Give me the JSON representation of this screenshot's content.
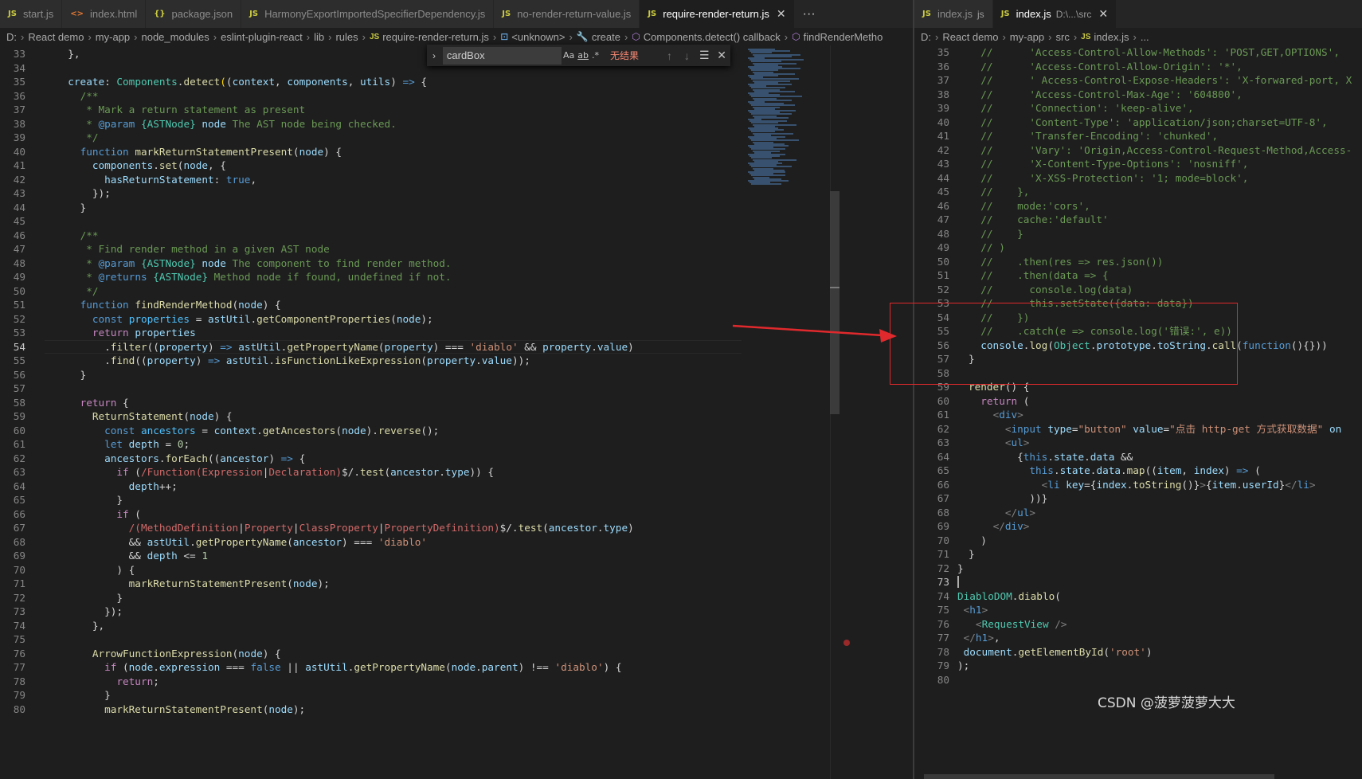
{
  "left_tabs": [
    {
      "icon": "JS",
      "label": "start.js",
      "active": false
    },
    {
      "icon": "<>",
      "label": "index.html",
      "active": false
    },
    {
      "icon": "{}",
      "label": "package.json",
      "active": false
    },
    {
      "icon": "JS",
      "label": "HarmonyExportImportedSpecifierDependency.js",
      "active": false
    },
    {
      "icon": "JS",
      "label": "no-render-return-value.js",
      "active": false
    },
    {
      "icon": "JS",
      "label": "require-render-return.js",
      "active": true
    }
  ],
  "left_more": "···",
  "right_tabs": [
    {
      "icon": "JS",
      "label": "index.js",
      "desc": "js",
      "active": false
    },
    {
      "icon": "JS",
      "label": "index.js",
      "desc": "D:\\...\\src",
      "active": true
    }
  ],
  "left_breadcrumbs": [
    "D:",
    "React demo",
    "my-app",
    "node_modules",
    "eslint-plugin-react",
    "lib",
    "rules",
    "require-render-return.js",
    "<unknown>",
    "create",
    "Components.detect() callback",
    "findRenderMetho"
  ],
  "right_breadcrumbs": [
    "D:",
    "React demo",
    "my-app",
    "src",
    "index.js",
    "..."
  ],
  "find": {
    "query": "cardBox",
    "case": "Aa",
    "word": "ab",
    "regex": ".*",
    "result": "无结果"
  },
  "left_lines": [
    {
      "n": "33",
      "h": "  },"
    },
    {
      "n": "34",
      "h": ""
    },
    {
      "n": "35",
      "h": "  <span class=\"v\">create</span>: <span class=\"cls\">Components</span>.<span class=\"f\">detect</span><span class=\"br\">(</span>(<span class=\"v\">context</span>, <span class=\"v\">components</span>, <span class=\"v\">utils</span>) <span class=\"k\">=&gt;</span> {"
    },
    {
      "n": "36",
      "h": "    <span class=\"cm\">/**</span>"
    },
    {
      "n": "37",
      "h": "<span class=\"cm\">     * Mark a return statement as present</span>"
    },
    {
      "n": "38",
      "h": "<span class=\"cm\">     * </span><span class=\"k\">@param</span> <span class=\"cls\">{ASTNode}</span> <span class=\"v\">node</span><span class=\"cm\"> The AST node being checked.</span>"
    },
    {
      "n": "39",
      "h": "<span class=\"cm\">     */</span>"
    },
    {
      "n": "40",
      "h": "    <span class=\"k\">function</span> <span class=\"f\">markReturnStatementPresent</span>(<span class=\"v\">node</span>) {"
    },
    {
      "n": "41",
      "h": "      <span class=\"v\">components</span>.<span class=\"f\">set</span>(<span class=\"v\">node</span>, {"
    },
    {
      "n": "42",
      "h": "        <span class=\"v\">hasReturnStatement</span>: <span class=\"k\">true</span>,"
    },
    {
      "n": "43",
      "h": "      });"
    },
    {
      "n": "44",
      "h": "    }"
    },
    {
      "n": "45",
      "h": ""
    },
    {
      "n": "46",
      "h": "    <span class=\"cm\">/**</span>"
    },
    {
      "n": "47",
      "h": "<span class=\"cm\">     * Find render method in a given AST node</span>"
    },
    {
      "n": "48",
      "h": "<span class=\"cm\">     * </span><span class=\"k\">@param</span> <span class=\"cls\">{ASTNode}</span> <span class=\"v\">node</span><span class=\"cm\"> The component to find render method.</span>"
    },
    {
      "n": "49",
      "h": "<span class=\"cm\">     * </span><span class=\"k\">@returns</span> <span class=\"cls\">{ASTNode}</span><span class=\"cm\"> Method node if found, undefined if not.</span>"
    },
    {
      "n": "50",
      "h": "<span class=\"cm\">     */</span>"
    },
    {
      "n": "51",
      "h": "    <span class=\"k\">function</span> <span class=\"f\">findRenderMethod</span>(<span class=\"v\">node</span>) {"
    },
    {
      "n": "52",
      "h": "      <span class=\"k\">const</span> <span class=\"cv\">properties</span> = <span class=\"v\">astUtil</span>.<span class=\"f\">getComponentProperties</span>(<span class=\"v\">node</span>);"
    },
    {
      "n": "53",
      "h": "      <span class=\"c\">return</span> <span class=\"v\">properties</span>"
    },
    {
      "n": "54",
      "h": "        .<span class=\"f\">filter</span>((<span class=\"v\">property</span>) <span class=\"k\">=&gt;</span> <span class=\"v\">astUtil</span>.<span class=\"f\">getPropertyName</span>(<span class=\"v\">property</span>) === <span class=\"s\">'diablo'</span> &amp;&amp; <span class=\"v\">property</span>.<span class=\"v\">value</span>)",
      "cur": true
    },
    {
      "n": "55",
      "h": "        .<span class=\"f\">find</span>((<span class=\"v\">property</span>) <span class=\"k\">=&gt;</span> <span class=\"v\">astUtil</span>.<span class=\"f\">isFunctionLikeExpression</span>(<span class=\"v\">property</span>.<span class=\"v\">value</span>));"
    },
    {
      "n": "56",
      "h": "    }"
    },
    {
      "n": "57",
      "h": ""
    },
    {
      "n": "58",
      "h": "    <span class=\"c\">return</span> {"
    },
    {
      "n": "59",
      "h": "      <span class=\"f\">ReturnStatement</span>(<span class=\"v\">node</span>) {"
    },
    {
      "n": "60",
      "h": "        <span class=\"k\">const</span> <span class=\"cv\">ancestors</span> = <span class=\"v\">context</span>.<span class=\"f\">getAncestors</span>(<span class=\"v\">node</span>).<span class=\"f\">reverse</span>();"
    },
    {
      "n": "61",
      "h": "        <span class=\"k\">let</span> <span class=\"v\">depth</span> = <span class=\"n\">0</span>;"
    },
    {
      "n": "62",
      "h": "        <span class=\"v\">ancestors</span>.<span class=\"f\">forEach</span>((<span class=\"v\">ancestor</span>) <span class=\"k\">=&gt;</span> {"
    },
    {
      "n": "63",
      "h": "          <span class=\"c\">if</span> (<span class=\"rx\">/Function(Expression</span>|<span class=\"rx\">Declaration)</span>$/.<span class=\"f\">test</span>(<span class=\"v\">ancestor</span>.<span class=\"v\">type</span>)) {"
    },
    {
      "n": "64",
      "h": "            <span class=\"v\">depth</span>++;"
    },
    {
      "n": "65",
      "h": "          }"
    },
    {
      "n": "66",
      "h": "          <span class=\"c\">if</span> ("
    },
    {
      "n": "67",
      "h": "            <span class=\"rx\">/(MethodDefinition</span>|<span class=\"rx\">Property</span>|<span class=\"rx\">ClassProperty</span>|<span class=\"rx\">PropertyDefinition)</span>$/.<span class=\"f\">test</span>(<span class=\"v\">ancestor</span>.<span class=\"v\">type</span>)"
    },
    {
      "n": "68",
      "h": "            &amp;&amp; <span class=\"v\">astUtil</span>.<span class=\"f\">getPropertyName</span>(<span class=\"v\">ancestor</span>) === <span class=\"s\">'diablo'</span>"
    },
    {
      "n": "69",
      "h": "            &amp;&amp; <span class=\"v\">depth</span> &lt;= <span class=\"n\">1</span>"
    },
    {
      "n": "70",
      "h": "          ) {"
    },
    {
      "n": "71",
      "h": "            <span class=\"f\">markReturnStatementPresent</span>(<span class=\"v\">node</span>);"
    },
    {
      "n": "72",
      "h": "          }"
    },
    {
      "n": "73",
      "h": "        });"
    },
    {
      "n": "74",
      "h": "      },"
    },
    {
      "n": "75",
      "h": ""
    },
    {
      "n": "76",
      "h": "      <span class=\"f\">ArrowFunctionExpression</span>(<span class=\"v\">node</span>) {"
    },
    {
      "n": "77",
      "h": "        <span class=\"c\">if</span> (<span class=\"v\">node</span>.<span class=\"v\">expression</span> === <span class=\"k\">false</span> || <span class=\"v\">astUtil</span>.<span class=\"f\">getPropertyName</span>(<span class=\"v\">node</span>.<span class=\"v\">parent</span>) !== <span class=\"s\">'diablo'</span>) {"
    },
    {
      "n": "78",
      "h": "          <span class=\"c\">return</span>;"
    },
    {
      "n": "79",
      "h": "        }"
    },
    {
      "n": "80",
      "h": "        <span class=\"f\">markReturnStatementPresent</span>(<span class=\"v\">node</span>);"
    }
  ],
  "right_lines": [
    {
      "n": "35",
      "h": "  <span class=\"cm\">//      'Access-Control-Allow-Methods': 'POST,GET,OPTIONS',</span>"
    },
    {
      "n": "36",
      "h": "  <span class=\"cm\">//      'Access-Control-Allow-Origin': '*',</span>"
    },
    {
      "n": "37",
      "h": "  <span class=\"cm\">//      ' Access-Control-Expose-Headers': 'X-forwared-port, X</span>"
    },
    {
      "n": "38",
      "h": "  <span class=\"cm\">//      'Access-Control-Max-Age': '604800',</span>"
    },
    {
      "n": "39",
      "h": "  <span class=\"cm\">//      'Connection': 'keep-alive',</span>"
    },
    {
      "n": "40",
      "h": "  <span class=\"cm\">//      'Content-Type': 'application/json;charset=UTF-8',</span>"
    },
    {
      "n": "41",
      "h": "  <span class=\"cm\">//      'Transfer-Encoding': 'chunked',</span>"
    },
    {
      "n": "42",
      "h": "  <span class=\"cm\">//      'Vary': 'Origin,Access-Control-Request-Method,Access-</span>"
    },
    {
      "n": "43",
      "h": "  <span class=\"cm\">//      'X-Content-Type-Options': 'nosniff',</span>"
    },
    {
      "n": "44",
      "h": "  <span class=\"cm\">//      'X-XSS-Protection': '1; mode=block',</span>"
    },
    {
      "n": "45",
      "h": "  <span class=\"cm\">//    },</span>"
    },
    {
      "n": "46",
      "h": "  <span class=\"cm\">//    mode:'cors',</span>"
    },
    {
      "n": "47",
      "h": "  <span class=\"cm\">//    cache:'default'</span>"
    },
    {
      "n": "48",
      "h": "  <span class=\"cm\">//    }</span>"
    },
    {
      "n": "49",
      "h": "  <span class=\"cm\">// )</span>"
    },
    {
      "n": "50",
      "h": "  <span class=\"cm\">//    .then(res =&gt; res.json())</span>"
    },
    {
      "n": "51",
      "h": "  <span class=\"cm\">//    .then(data =&gt; {</span>"
    },
    {
      "n": "52",
      "h": "  <span class=\"cm\">//      console.log(data)</span>"
    },
    {
      "n": "53",
      "h": "  <span class=\"cm\">//      this.setState({data: data})</span>"
    },
    {
      "n": "54",
      "h": "  <span class=\"cm\">//    })</span>"
    },
    {
      "n": "55",
      "h": "  <span class=\"cm\">//    .catch(e =&gt; console.log('错误:', e))</span>"
    },
    {
      "n": "56",
      "h": "  <span class=\"v\">console</span>.<span class=\"f\">log</span>(<span class=\"cls\">Object</span>.<span class=\"v\">prototype</span>.<span class=\"v\">toString</span>.<span class=\"f\">call</span>(<span class=\"k\">function</span>(){}))"
    },
    {
      "n": "57",
      "h": "}"
    },
    {
      "n": "58",
      "h": ""
    },
    {
      "n": "59",
      "h": "<span class=\"f\">render</span>() {"
    },
    {
      "n": "60",
      "h": "  <span class=\"c\">return</span> ("
    },
    {
      "n": "61",
      "h": "    <span class=\"tg\">&lt;</span><span class=\"t\">div</span><span class=\"tg\">&gt;</span>"
    },
    {
      "n": "62",
      "h": "      <span class=\"tg\">&lt;</span><span class=\"t\">input</span> <span class=\"at\">type</span>=<span class=\"s\">\"button\"</span> <span class=\"at\">value</span>=<span class=\"s\">\"点击 http-get 方式获取数据\"</span> <span class=\"at\">on</span>"
    },
    {
      "n": "63",
      "h": "      <span class=\"tg\">&lt;</span><span class=\"t\">ul</span><span class=\"tg\">&gt;</span>"
    },
    {
      "n": "64",
      "h": "        {<span class=\"k\">this</span>.<span class=\"v\">state</span>.<span class=\"v\">data</span> &amp;&amp;"
    },
    {
      "n": "65",
      "h": "          <span class=\"k\">this</span>.<span class=\"v\">state</span>.<span class=\"v\">data</span>.<span class=\"f\">map</span>((<span class=\"v\">item</span>, <span class=\"v\">index</span>) <span class=\"k\">=&gt;</span> ("
    },
    {
      "n": "66",
      "h": "            <span class=\"tg\">&lt;</span><span class=\"t\">li</span> <span class=\"at\">key</span>={<span class=\"v\">index</span>.<span class=\"f\">toString</span>()}<span class=\"tg\">&gt;</span>{<span class=\"v\">item</span>.<span class=\"v\">userId</span>}<span class=\"tg\">&lt;/</span><span class=\"t\">li</span><span class=\"tg\">&gt;</span>"
    },
    {
      "n": "67",
      "h": "          ))}"
    },
    {
      "n": "68",
      "h": "      <span class=\"tg\">&lt;/</span><span class=\"t\">ul</span><span class=\"tg\">&gt;</span>"
    },
    {
      "n": "69",
      "h": "    <span class=\"tg\">&lt;/</span><span class=\"t\">div</span><span class=\"tg\">&gt;</span>"
    },
    {
      "n": "70",
      "h": "  )"
    },
    {
      "n": "71",
      "h": "}"
    },
    {
      "n": "72",
      "h": "}",
      "shift": -1
    },
    {
      "n": "73",
      "h": "",
      "cur": true
    },
    {
      "n": "74",
      "h": "<span class=\"cls\">DiabloDOM</span>.<span class=\"f\">diablo</span>(",
      "shift": -1
    },
    {
      "n": "75",
      "h": " <span class=\"tg\">&lt;</span><span class=\"t\">h1</span><span class=\"tg\">&gt;</span>",
      "shift": -1
    },
    {
      "n": "76",
      "h": "   <span class=\"tg\">&lt;</span><span class=\"cls\">RequestView</span> <span class=\"tg\">/&gt;</span>",
      "shift": -1
    },
    {
      "n": "77",
      "h": " <span class=\"tg\">&lt;/</span><span class=\"t\">h1</span><span class=\"tg\">&gt;</span>,",
      "shift": -1
    },
    {
      "n": "78",
      "h": " <span class=\"v\">document</span>.<span class=\"f\">getElementById</span>(<span class=\"s\">'root'</span>)",
      "shift": -1
    },
    {
      "n": "79",
      "h": ");",
      "shift": -1
    },
    {
      "n": "80",
      "h": ""
    }
  ],
  "watermark": "CSDN @菠萝菠萝大大"
}
